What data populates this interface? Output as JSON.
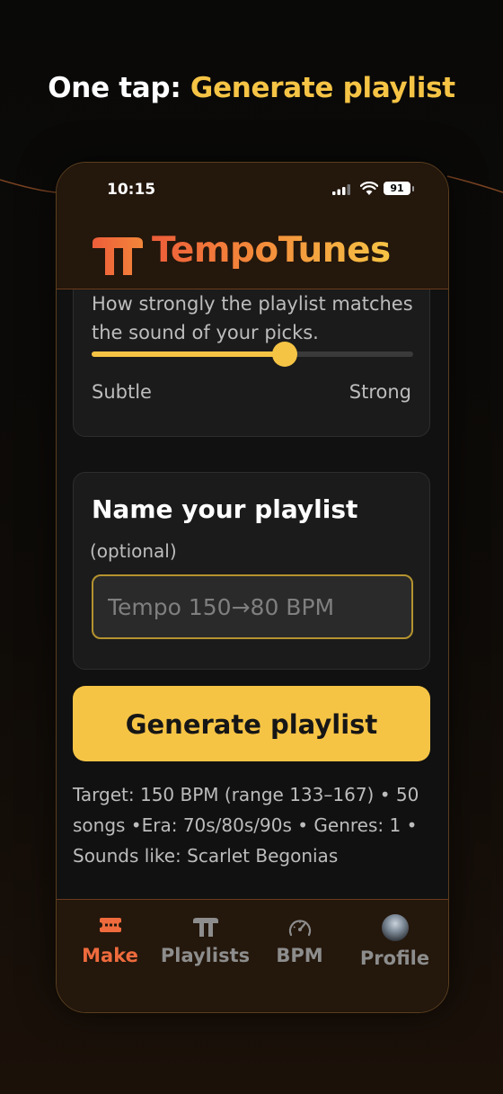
{
  "headline": {
    "prefix": "One tap: ",
    "accent": "Generate playlist"
  },
  "status_bar": {
    "time": "10:15",
    "battery": "91"
  },
  "app": {
    "brand": "TempoTunes"
  },
  "similarity_card": {
    "description": "How strongly the playlist matches the sound of your picks.",
    "slider_value_fraction": 0.6,
    "min_label": "Subtle",
    "max_label": "Strong"
  },
  "name_card": {
    "title": "Name your playlist",
    "subtitle": "(optional)",
    "placeholder": "Tempo 150→80 BPM"
  },
  "generate_button": {
    "label": "Generate playlist"
  },
  "summary": "Target: 150 BPM (range 133–167) • 50 songs •Era: 70s/80s/90s • Genres: 1 • Sounds like: Scarlet Begonias",
  "tabs": [
    {
      "label": "Make",
      "icon": "ticket-icon",
      "active": true
    },
    {
      "label": "Playlists",
      "icon": "tempo-logo-icon",
      "active": false
    },
    {
      "label": "BPM",
      "icon": "gauge-icon",
      "active": false
    },
    {
      "label": "Profile",
      "icon": "avatar-photo",
      "active": false
    }
  ],
  "colors": {
    "accent_yellow": "#f6c445",
    "accent_orange": "#ef6b3d",
    "surface": "#1b1b1b",
    "header_bg": "#24170c"
  }
}
